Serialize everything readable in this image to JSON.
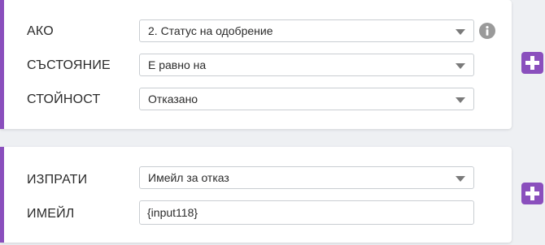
{
  "condition_block": {
    "if_label": "АКО",
    "if_value": "2. Статус на одобрение",
    "state_label": "СЪСТОЯНИЕ",
    "state_value": "Е равно на",
    "value_label": "СТОЙНОСТ",
    "value_value": "Отказано",
    "info_icon": "info-icon"
  },
  "action_block": {
    "send_label": "ИЗПРАТИ",
    "send_value": "Имейл за отказ",
    "email_label": "ИМЕЙЛ",
    "email_value": "{input118}"
  },
  "add_icon": "plus-icon",
  "colors": {
    "accent": "#8a4fbd",
    "info": "#9a9a9a"
  }
}
